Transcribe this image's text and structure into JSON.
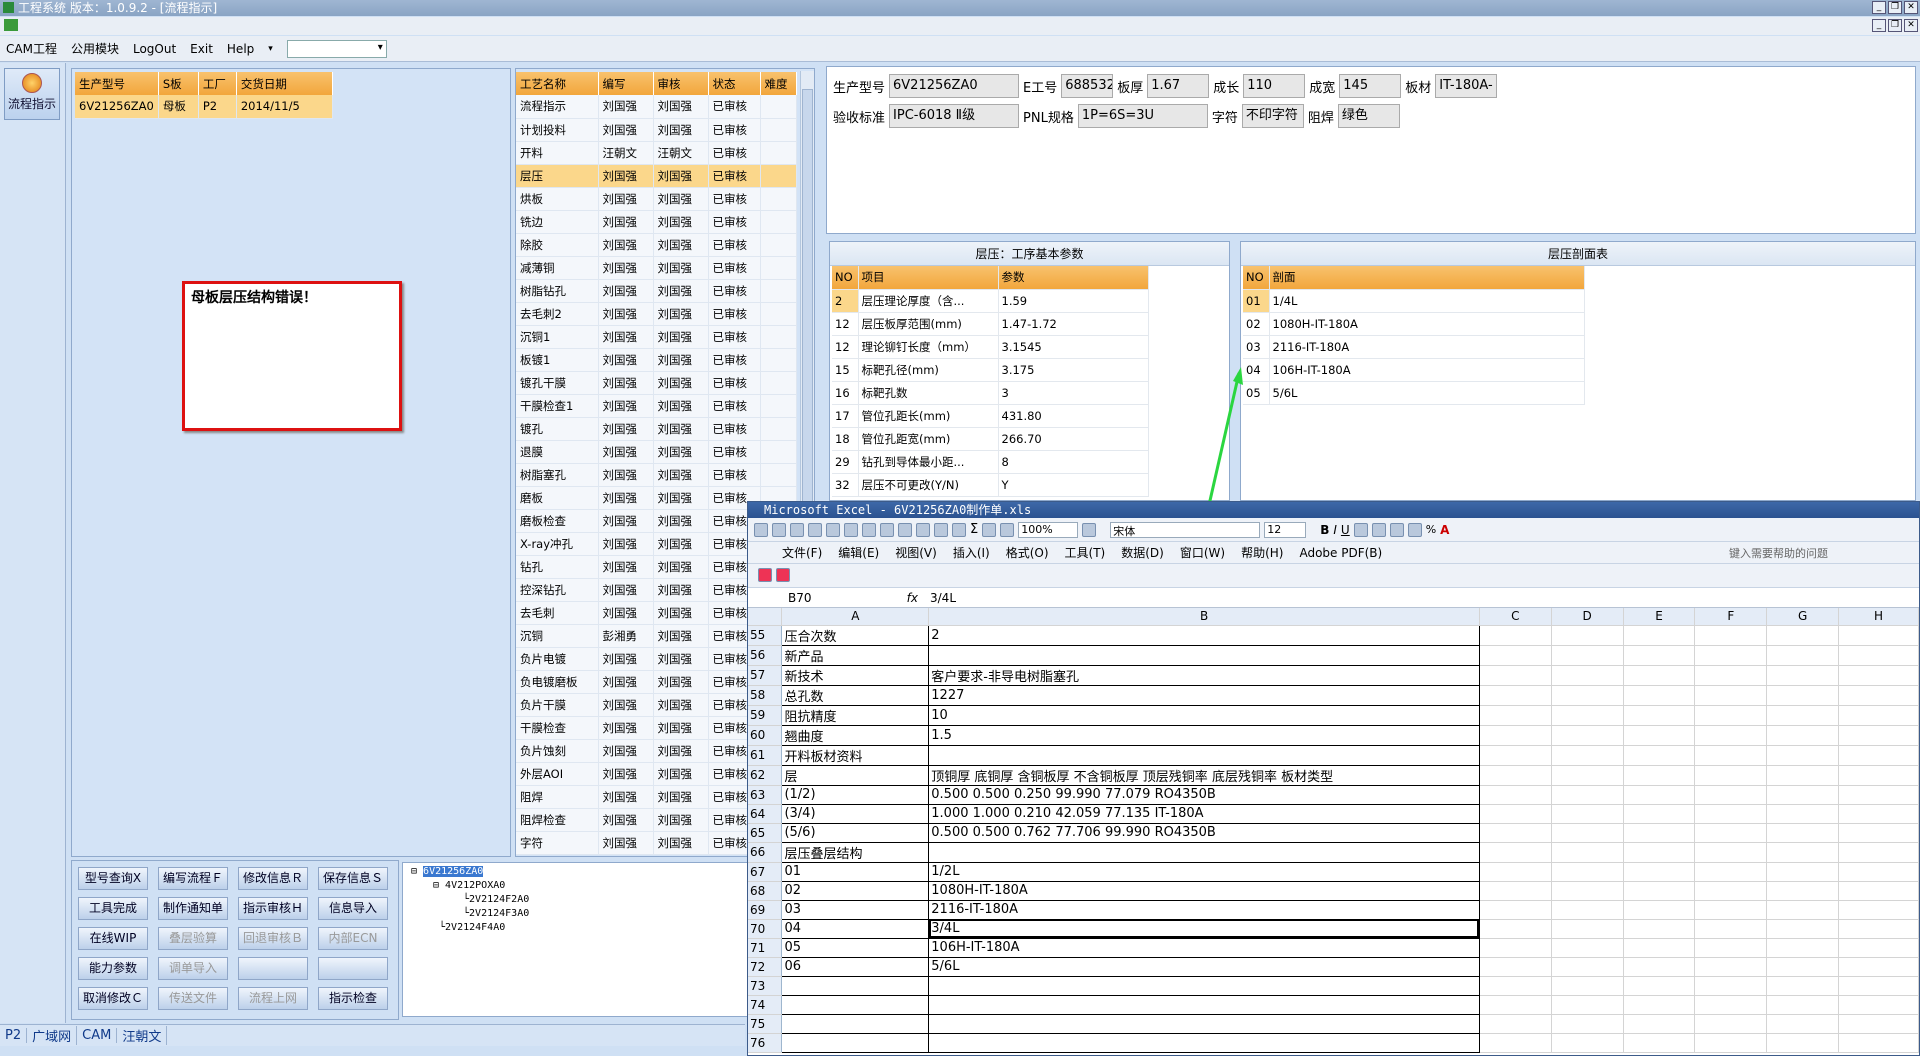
{
  "app": {
    "title": "工程系统   版本：1.0.9.2 - [流程指示]",
    "menu": [
      "CAM工程",
      "公用模块",
      "LogOut",
      "Exit",
      "Help"
    ],
    "combo_value": ""
  },
  "sidebar": {
    "flow_label": "流程指示"
  },
  "order_table": {
    "headers": [
      "生产型号",
      "S板",
      "工厂",
      "交货日期"
    ],
    "row": [
      "6V21256ZA0",
      "母板",
      "P2",
      "2014/11/5"
    ]
  },
  "error_message": "母板层压结构错误！",
  "process_table": {
    "headers": [
      "工艺名称",
      "编写",
      "审核",
      "状态",
      "难度"
    ],
    "rows": [
      [
        "流程指示",
        "刘国强",
        "刘国强",
        "已审核"
      ],
      [
        "计划投料",
        "刘国强",
        "刘国强",
        "已审核"
      ],
      [
        "开料",
        "汪朝文",
        "汪朝文",
        "已审核"
      ],
      [
        "层压",
        "刘国强",
        "刘国强",
        "已审核"
      ],
      [
        "烘板",
        "刘国强",
        "刘国强",
        "已审核"
      ],
      [
        "铣边",
        "刘国强",
        "刘国强",
        "已审核"
      ],
      [
        "除胶",
        "刘国强",
        "刘国强",
        "已审核"
      ],
      [
        "减薄铜",
        "刘国强",
        "刘国强",
        "已审核"
      ],
      [
        "树脂钻孔",
        "刘国强",
        "刘国强",
        "已审核"
      ],
      [
        "去毛刺2",
        "刘国强",
        "刘国强",
        "已审核"
      ],
      [
        "沉铜1",
        "刘国强",
        "刘国强",
        "已审核"
      ],
      [
        "板镀1",
        "刘国强",
        "刘国强",
        "已审核"
      ],
      [
        "镀孔干膜",
        "刘国强",
        "刘国强",
        "已审核"
      ],
      [
        "干膜检查1",
        "刘国强",
        "刘国强",
        "已审核"
      ],
      [
        "镀孔",
        "刘国强",
        "刘国强",
        "已审核"
      ],
      [
        "退膜",
        "刘国强",
        "刘国强",
        "已审核"
      ],
      [
        "树脂塞孔",
        "刘国强",
        "刘国强",
        "已审核"
      ],
      [
        "磨板",
        "刘国强",
        "刘国强",
        "已审核"
      ],
      [
        "磨板检查",
        "刘国强",
        "刘国强",
        "已审核"
      ],
      [
        "X-ray冲孔",
        "刘国强",
        "刘国强",
        "已审核"
      ],
      [
        "钻孔",
        "刘国强",
        "刘国强",
        "已审核"
      ],
      [
        "控深钻孔",
        "刘国强",
        "刘国强",
        "已审核"
      ],
      [
        "去毛刺",
        "刘国强",
        "刘国强",
        "已审核"
      ],
      [
        "沉铜",
        "彭湘勇",
        "刘国强",
        "已审核"
      ],
      [
        "负片电镀",
        "刘国强",
        "刘国强",
        "已审核"
      ],
      [
        "负电镀磨板",
        "刘国强",
        "刘国强",
        "已审核"
      ],
      [
        "负片干膜",
        "刘国强",
        "刘国强",
        "已审核"
      ],
      [
        "干膜检查",
        "刘国强",
        "刘国强",
        "已审核"
      ],
      [
        "负片蚀刻",
        "刘国强",
        "刘国强",
        "已审核"
      ],
      [
        "外层AOI",
        "刘国强",
        "刘国强",
        "已审核"
      ],
      [
        "阻焊",
        "刘国强",
        "刘国强",
        "已审核"
      ],
      [
        "阻焊检查",
        "刘国强",
        "刘国强",
        "已审核"
      ],
      [
        "字符",
        "刘国强",
        "刘国强",
        "已审核"
      ]
    ]
  },
  "buttons": [
    [
      "型号查询Ⅹ",
      "编写流程Ｆ",
      "修改信息Ｒ",
      "保存信息Ｓ"
    ],
    [
      "工具完成",
      "制作通知单",
      "指示审核Ｈ",
      "信息导入"
    ],
    [
      "在线WIP",
      "叠层验算",
      "回退审核Ｂ",
      "内部ECN"
    ],
    [
      "能力参数",
      "调单导入",
      "",
      ""
    ],
    [
      "取消修改Ｃ",
      "传送文件",
      "流程上网",
      "指示检查"
    ]
  ],
  "tree": {
    "root": "6V21256ZA0",
    "child": "4V212POXA0",
    "leaves": [
      "2V2124F2A0",
      "2V2124F3A0"
    ],
    "sibling": "2V2124F4A0"
  },
  "info": {
    "row1": [
      [
        "生产型号",
        "6V21256ZA0"
      ],
      [
        "E工号",
        "688532"
      ],
      [
        "板厚",
        "1.67"
      ],
      [
        "成长",
        "110"
      ],
      [
        "成宽",
        "145"
      ],
      [
        "板材",
        "IT-180A-"
      ]
    ],
    "row2": [
      [
        "验收标准",
        "IPC-6018 Ⅱ级"
      ],
      [
        "PNL规格",
        "1P=6S=3U"
      ],
      [
        "字符",
        "不印字符"
      ],
      [
        "阻焊",
        "绿色"
      ]
    ]
  },
  "params": {
    "title": "层压：工序基本参数",
    "headers": [
      "NO",
      "项目",
      "参数"
    ],
    "rows": [
      [
        "2",
        "层压理论厚度（含...",
        "1.59"
      ],
      [
        "12",
        "层压板厚范围(mm)",
        "1.47-1.72"
      ],
      [
        "12",
        "理论铆钉长度（mm）",
        "3.1545"
      ],
      [
        "15",
        "标靶孔径(mm)",
        "3.175"
      ],
      [
        "16",
        "标靶孔数",
        "3"
      ],
      [
        "17",
        "管位孔距长(mm)",
        "431.80"
      ],
      [
        "18",
        "管位孔距宽(mm)",
        "266.70"
      ],
      [
        "29",
        "钻孔到导体最小距...",
        "8"
      ],
      [
        "32",
        "层压不可更改(Y/N)",
        "Y"
      ]
    ]
  },
  "section": {
    "title": "层压剖面表",
    "headers": [
      "NO",
      "剖面"
    ],
    "rows": [
      [
        "01",
        "1/4L"
      ],
      [
        "02",
        "1080H-IT-180A"
      ],
      [
        "03",
        "2116-IT-180A"
      ],
      [
        "04",
        "106H-IT-180A"
      ],
      [
        "05",
        "5/6L"
      ]
    ]
  },
  "excel": {
    "title": "Microsoft Excel - 6V21256ZA0制作单.xls",
    "zoom": "100%",
    "font": "宋体",
    "font_size": "12",
    "menu": [
      "文件(F)",
      "编辑(E)",
      "视图(V)",
      "插入(I)",
      "格式(O)",
      "工具(T)",
      "数据(D)",
      "窗口(W)",
      "帮助(H)",
      "Adobe PDF(B)"
    ],
    "help_placeholder": "键入需要帮助的问题",
    "name_box": "B70",
    "formula": "3/4L",
    "columns": [
      "A",
      "B",
      "C",
      "D",
      "E",
      "F",
      "G",
      "H"
    ],
    "rows": [
      [
        "55",
        "压合次数",
        "2"
      ],
      [
        "56",
        "新产品",
        ""
      ],
      [
        "57",
        "新技术",
        "客户要求-非导电树脂塞孔"
      ],
      [
        "58",
        "总孔数",
        "1227"
      ],
      [
        "59",
        "阻抗精度",
        "10"
      ],
      [
        "60",
        "翘曲度",
        "1.5"
      ],
      [
        "61",
        "开料板材资料",
        ""
      ],
      [
        "62",
        "层",
        "顶铜厚  底铜厚  含铜板厚  不含铜板厚  顶层残铜率  底层残铜率  板材类型"
      ],
      [
        "63",
        "(1/2)",
        "0.500   0.500         0.250      99.990     77.079      RO4350B"
      ],
      [
        "64",
        "(3/4)",
        "1.000   1.000         0.210      42.059     77.135      IT-180A"
      ],
      [
        "65",
        "(5/6)",
        "0.500   0.500         0.762      77.706     99.990      RO4350B"
      ],
      [
        "66",
        "层压叠层结构",
        ""
      ],
      [
        "67",
        "01",
        "1/2L"
      ],
      [
        "68",
        "02",
        "1080H-IT-180A"
      ],
      [
        "69",
        "03",
        "2116-IT-180A"
      ],
      [
        "70",
        "04",
        "3/4L"
      ],
      [
        "71",
        "05",
        "106H-IT-180A"
      ],
      [
        "72",
        "06",
        "5/6L"
      ],
      [
        "73",
        "",
        ""
      ],
      [
        "74",
        "",
        ""
      ],
      [
        "75",
        "",
        ""
      ],
      [
        "76",
        "",
        ""
      ]
    ]
  },
  "status": [
    "P2",
    "广域网",
    "CAM",
    "汪朝文"
  ]
}
